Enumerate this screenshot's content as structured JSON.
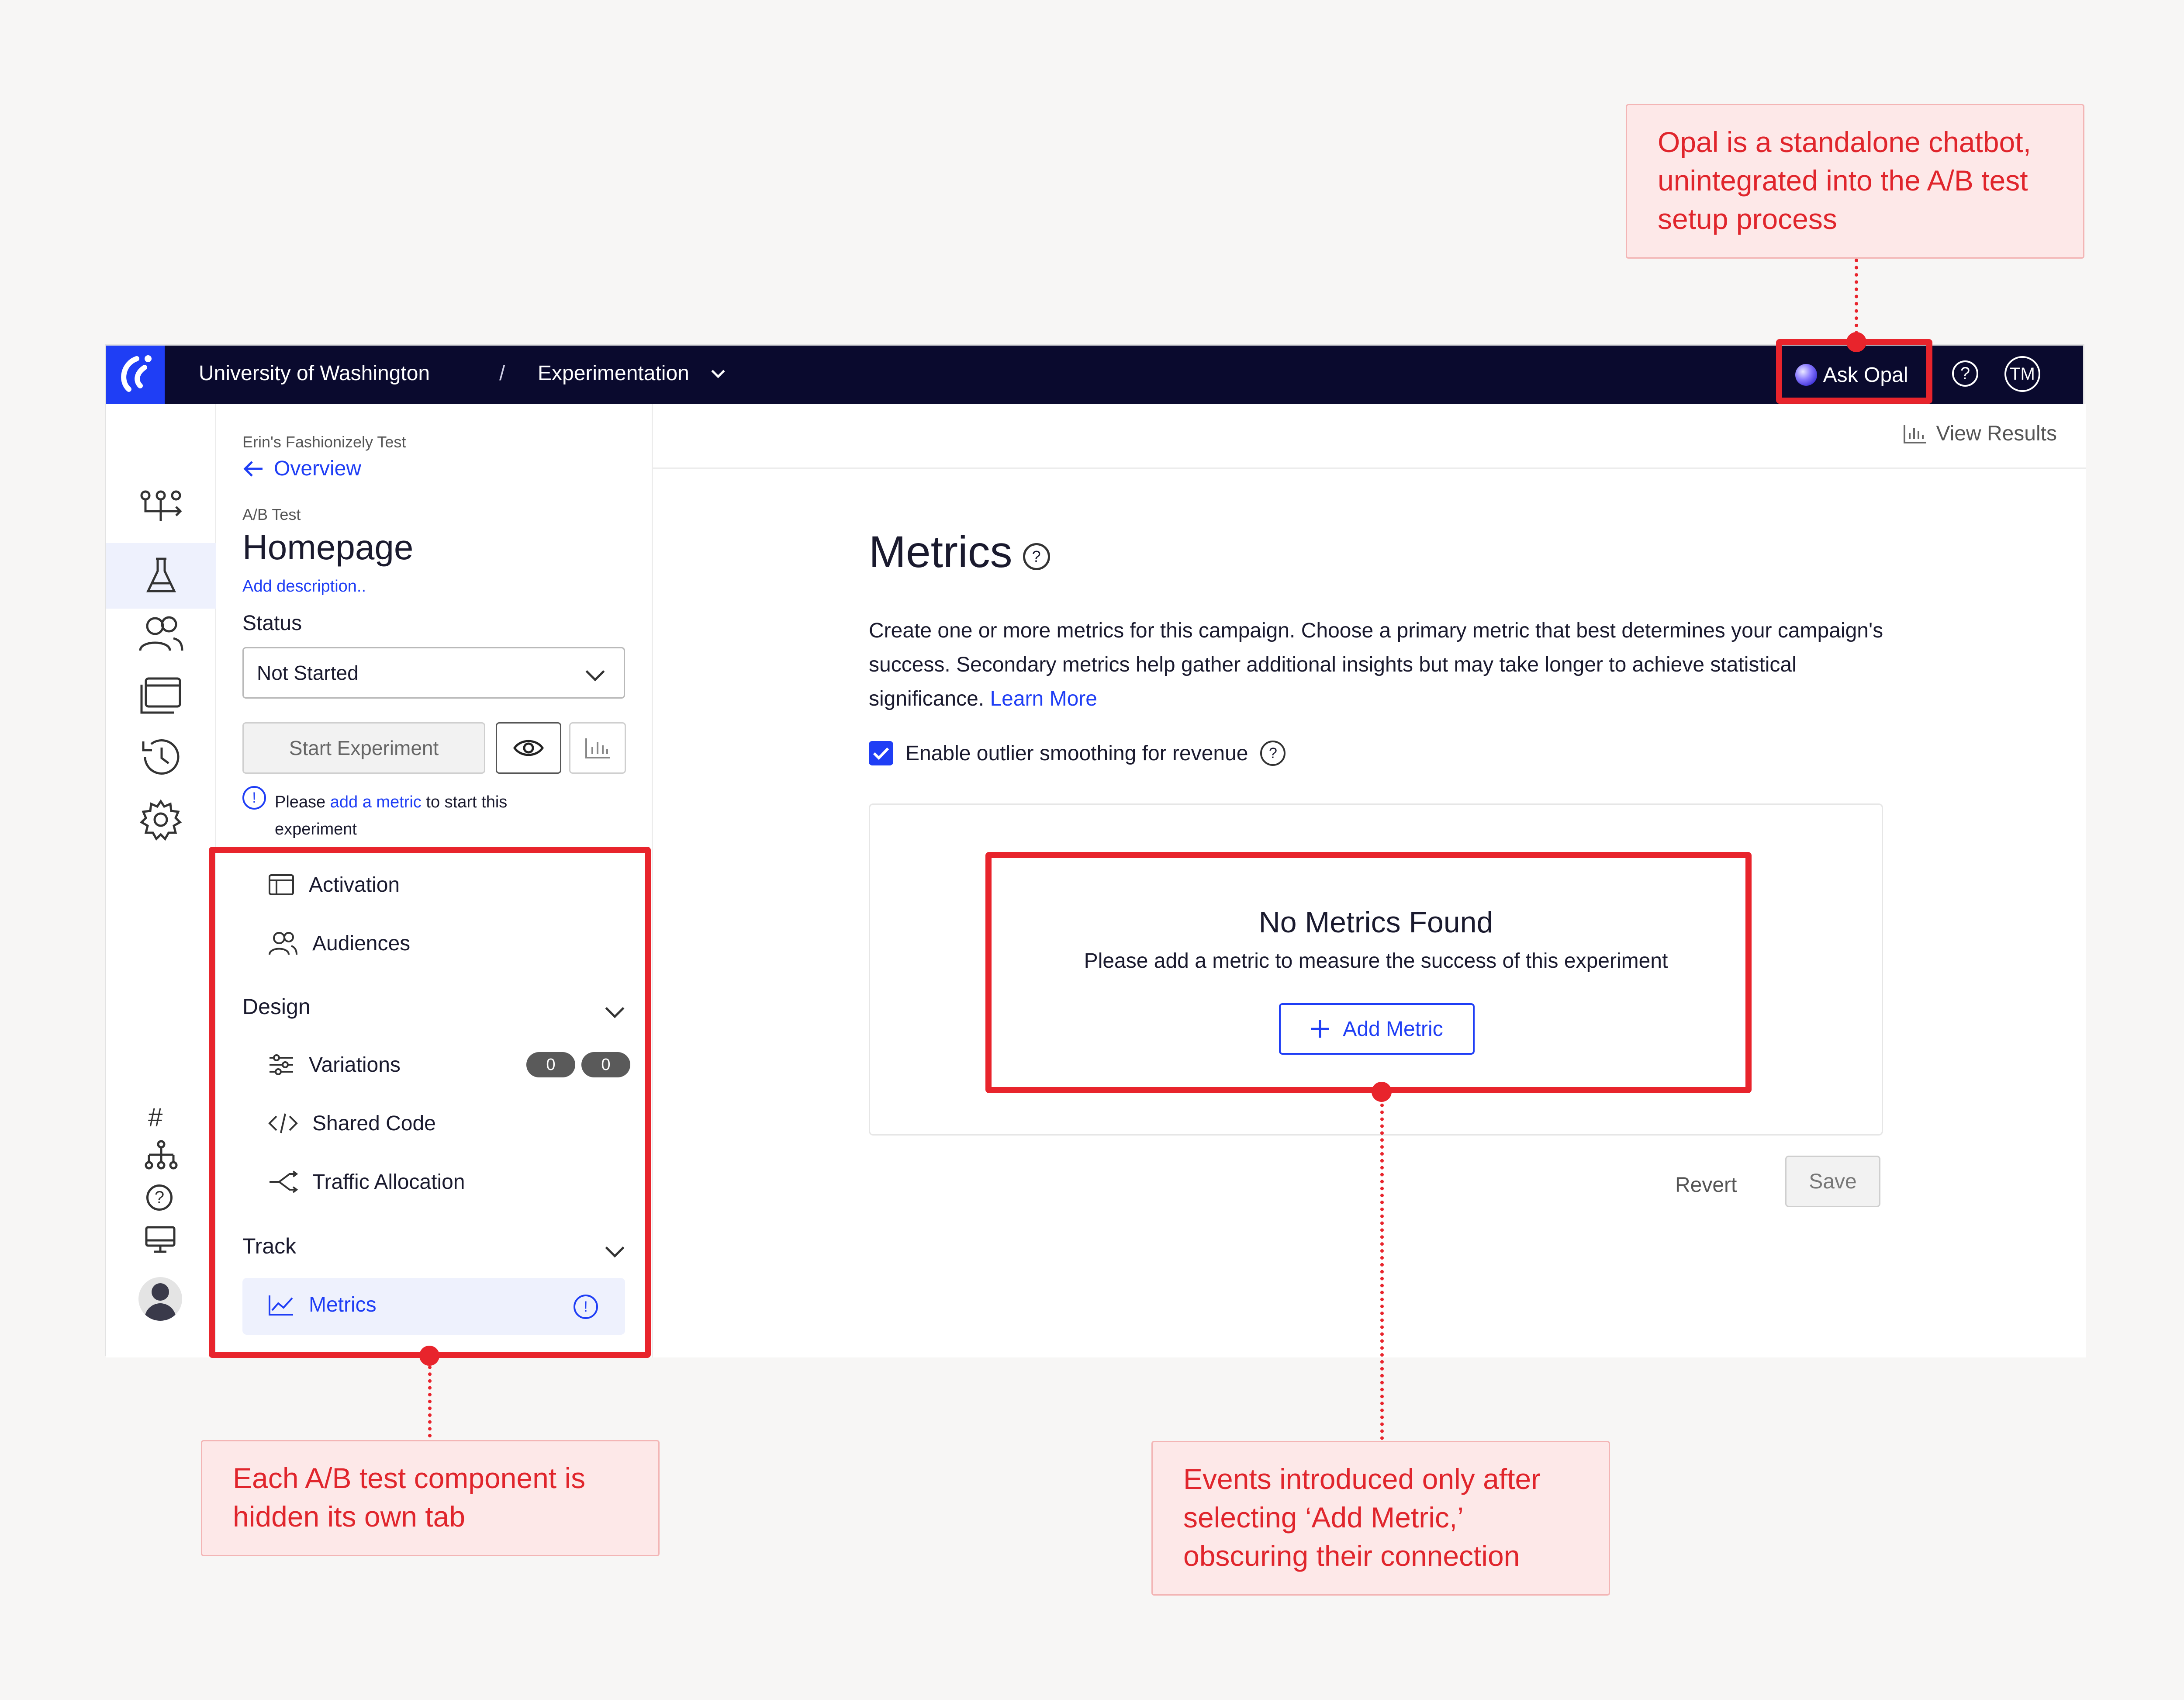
{
  "topbar": {
    "org": "University of Washington",
    "separator": "/",
    "product": "Experimentation",
    "ask_opal": "Ask Opal",
    "help": "?",
    "user_initials": "TM"
  },
  "sidebar": {
    "project": "Erin's Fashionizely Test",
    "back_link": "Overview",
    "type": "A/B Test",
    "name": "Homepage",
    "add_description": "Add description..",
    "status_label": "Status",
    "status_value": "Not Started",
    "start_button": "Start Experiment",
    "notice_prefix": "Please",
    "notice_link": "add a metric",
    "notice_suffix": "to start this",
    "notice_line2": "experiment",
    "items": {
      "activation": "Activation",
      "audiences": "Audiences",
      "design_section": "Design",
      "variations": "Variations",
      "variations_counts": [
        "0",
        "0"
      ],
      "shared_code": "Shared Code",
      "traffic_allocation": "Traffic Allocation",
      "track_section": "Track",
      "metrics": "Metrics"
    }
  },
  "main": {
    "view_results": "View Results",
    "title": "Metrics",
    "description": "Create one or more metrics for this campaign. Choose a primary metric that best determines your campaign's success. Secondary metrics help gather additional insights but may take longer to achieve statistical significance.",
    "learn_more": "Learn More",
    "outlier_label": "Enable outlier smoothing for revenue",
    "outlier_checked": true,
    "empty_title": "No Metrics Found",
    "empty_subtitle": "Please add a metric to measure the success of this experiment",
    "add_metric": "Add Metric",
    "revert": "Revert",
    "save": "Save"
  },
  "annotations": {
    "opal": "Opal is a standalone chatbot, unintegrated into the A/B test setup process",
    "tabs": "Each A/B test component is hidden its own tab",
    "events": "Events introduced only after selecting ‘Add Metric,’ obscuring their connection"
  },
  "colors": {
    "topbar": "#0a0a2e",
    "brand_blue": "#1f3ef5",
    "annotation_red": "#e8242c",
    "annotation_bg": "#fde8e8"
  }
}
